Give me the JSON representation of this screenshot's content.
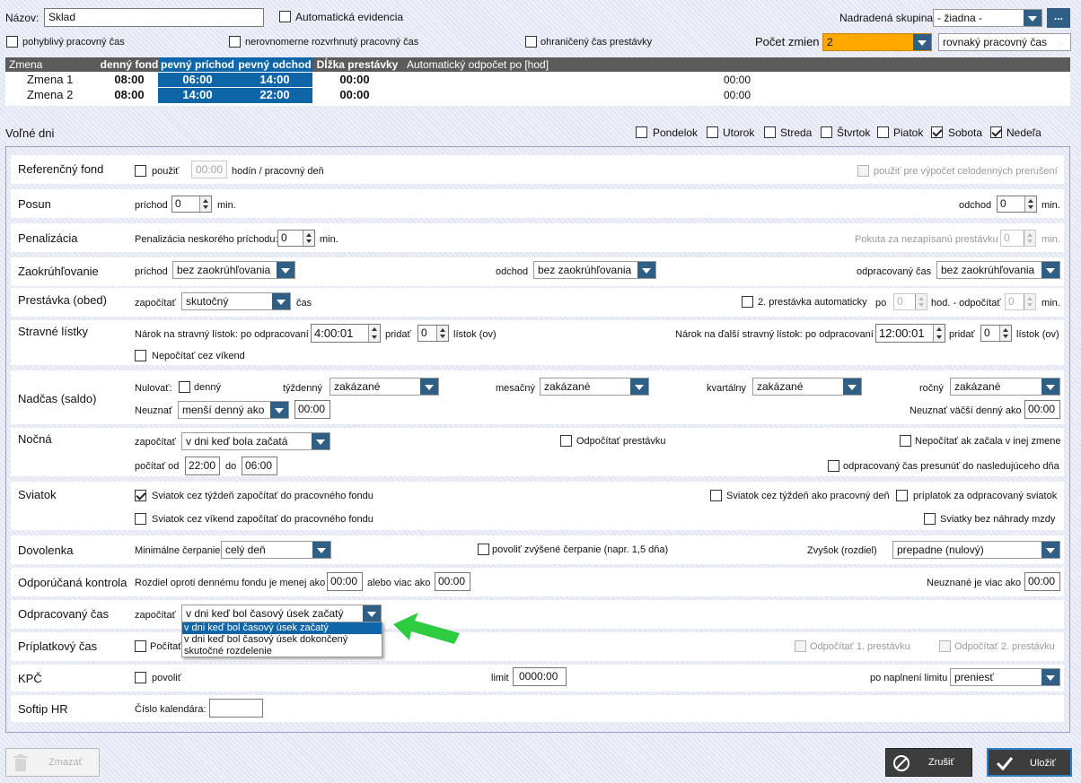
{
  "header": {
    "name_label": "Názov:",
    "name_value": "Sklad",
    "auto_evidence_label": "Automatická evidencia",
    "parent_group_label": "Nadradená skupina:",
    "parent_group_value": "- žiadna -",
    "more_button": "...",
    "flex_time_label": "pohyblivý pracovný čas",
    "uneven_time_label": "nerovnomerne rozvrhnutý pracovný čas",
    "limited_break_label": "ohraničený čas prestávky",
    "shift_count_label": "Počet zmien",
    "shift_count_value": "2",
    "time_type_value": "rovnaký pracovný čas"
  },
  "shifts": {
    "columns": [
      "Zmena",
      "denný fond",
      "pevný príchod",
      "pevný odchod",
      "Dĺžka prestávky",
      "Automatický odpočet po [hod]"
    ],
    "rows": [
      {
        "name": "Zmena 1",
        "fund": "08:00",
        "arrival": "06:00",
        "departure": "14:00",
        "break": "00:00",
        "auto": "00:00"
      },
      {
        "name": "Zmena 2",
        "fund": "08:00",
        "arrival": "14:00",
        "departure": "22:00",
        "break": "00:00",
        "auto": "00:00"
      }
    ]
  },
  "free_days": {
    "label": "Voľné dni",
    "days": [
      {
        "label": "Pondelok",
        "checked": false
      },
      {
        "label": "Utorok",
        "checked": false
      },
      {
        "label": "Streda",
        "checked": false
      },
      {
        "label": "Štvrtok",
        "checked": false
      },
      {
        "label": "Piatok",
        "checked": false
      },
      {
        "label": "Sobota",
        "checked": true
      },
      {
        "label": "Nedeľa",
        "checked": true
      }
    ]
  },
  "ref_fund": {
    "title": "Referenčný fond",
    "use_label": "použiť",
    "hours_value": "00:00",
    "unit": "hodín / pracovný deň",
    "interruption_label": "použiť pre výpočet celodenných prerušení"
  },
  "shift_offset": {
    "title": "Posun",
    "arrival_label": "príchod",
    "arrival_value": "0",
    "min": "min.",
    "departure_label": "odchod",
    "departure_value": "0"
  },
  "penalty": {
    "title": "Penalizácia",
    "late_label": "Penalizácia neskorého príchodu:",
    "late_value": "0",
    "min": "min.",
    "fine_label": "Pokuta za nezapísanú prestávku",
    "fine_value": "0"
  },
  "rounding": {
    "title": "Zaokrúhľovanie",
    "arrival_label": "príchod",
    "arrival_value": "bez zaokrúhľovania",
    "departure_label": "odchod",
    "departure_value": "bez zaokrúhľovania",
    "worked_label": "odpracovaný čas",
    "worked_value": "bez zaokrúhľovania"
  },
  "lunch": {
    "title": "Prestávka (obed)",
    "count_label": "započítať",
    "count_value": "skutočný",
    "time_label": "čas",
    "second_label": "2. prestávka automaticky",
    "after_label": "po",
    "after_value": "0",
    "hours_label": "hod. - odpočítať",
    "subtract_value": "0",
    "min": "min."
  },
  "meal": {
    "title": "Stravné lístky",
    "claim_label": "Nárok na stravný lístok: po odpracovaní",
    "claim_value": "4:00:01",
    "add_label": "pridať",
    "add_value": "0",
    "tickets_label": "lístok (ov)",
    "next_label": "Nárok na ďalší stravný lístok: po odpracovaní",
    "next_value": "12:00:01",
    "add2_value": "0",
    "weekend_label": "Nepočítať cez víkend"
  },
  "overtime": {
    "title": "Nadčas (saldo)",
    "reset_label": "Nulovať:",
    "daily_label": "denný",
    "weekly_label": "týždenný",
    "weekly_value": "zakázané",
    "monthly_label": "mesačný",
    "monthly_value": "zakázané",
    "quarterly_label": "kvartálny",
    "quarterly_value": "zakázané",
    "yearly_label": "ročný",
    "yearly_value": "zakázané",
    "ignore_label": "Neuznať",
    "ignore_value": "menší denný ako",
    "ignore_time": "00:00",
    "ignore_more_label": "Neuznať väčší denný ako",
    "ignore_more_time": "00:00"
  },
  "night": {
    "title": "Nočná",
    "count_label": "započítať",
    "count_value": "v dni keď bola začatá",
    "subtract_break_label": "Odpočítať prestávku",
    "not_other_label": "Nepočítať ak začala v inej zmene",
    "from_label": "počítať od",
    "from_value": "22:00",
    "to_label": "do",
    "to_value": "06:00",
    "move_label": "odpracovaný čas presunúť do nasledujúceho dňa"
  },
  "holiday": {
    "title": "Sviatok",
    "week_fund_label": "Sviatok cez týždeň započítať do pracovného fondu",
    "week_work_label": "Sviatok cez týždeň ako pracovný deň",
    "bonus_label": "príplatok za odpracovaný sviatok",
    "weekend_fund_label": "Sviatok cez víkend započítať do pracovného fondu",
    "no_comp_label": "Sviatky bez náhrady mzdy"
  },
  "vacation": {
    "title": "Dovolenka",
    "min_label": "Minimálne čerpanie",
    "min_value": "celý deň",
    "increased_label": "povoliť zvýšené čerpanie (napr. 1,5 dňa)",
    "rest_label": "Zvyšok (rozdiel)",
    "rest_value": "prepadne (nulový)"
  },
  "check": {
    "title": "Odporúčaná kontrola",
    "diff_label": "Rozdiel oproti dennému fondu je menej ako",
    "less_value": "00:00",
    "or_label": "alebo viac ako",
    "more_value": "00:00",
    "unrecog_label": "Neuznané je viac ako",
    "unrecog_value": "00:00"
  },
  "worked": {
    "title": "Odpracovaný čas",
    "count_label": "započítať",
    "count_value": "v dni keď bol časový úsek  začatý",
    "options": [
      "v dni keď bol časový úsek  začatý",
      "v dni keď bol časový úsek dokončený",
      "skutočné rozdelenie"
    ]
  },
  "surcharge": {
    "title": "Príplatkový čas",
    "count_label": "Počítať",
    "sub1_label": "Odpočítať 1. prestávku",
    "sub2_label": "Odpočítať 2. prestávku"
  },
  "kpc": {
    "title": "KPČ",
    "allow_label": "povoliť",
    "limit_label": "limit",
    "limit_value": "0000:00",
    "after_label": "po naplnení limitu",
    "after_value": "preniesť"
  },
  "softip": {
    "title": "Softip HR",
    "calendar_label": "Číslo kalendára:",
    "calendar_value": ""
  },
  "footer": {
    "delete_label": "Zmazať",
    "cancel_label": "Zrušiť",
    "save_label": "Uložiť"
  },
  "colors": {
    "accent": "#2f5f84",
    "highlight": "#0e66a8",
    "shift_count_bg": "#ffa800",
    "arrow": "#2ecc40"
  }
}
